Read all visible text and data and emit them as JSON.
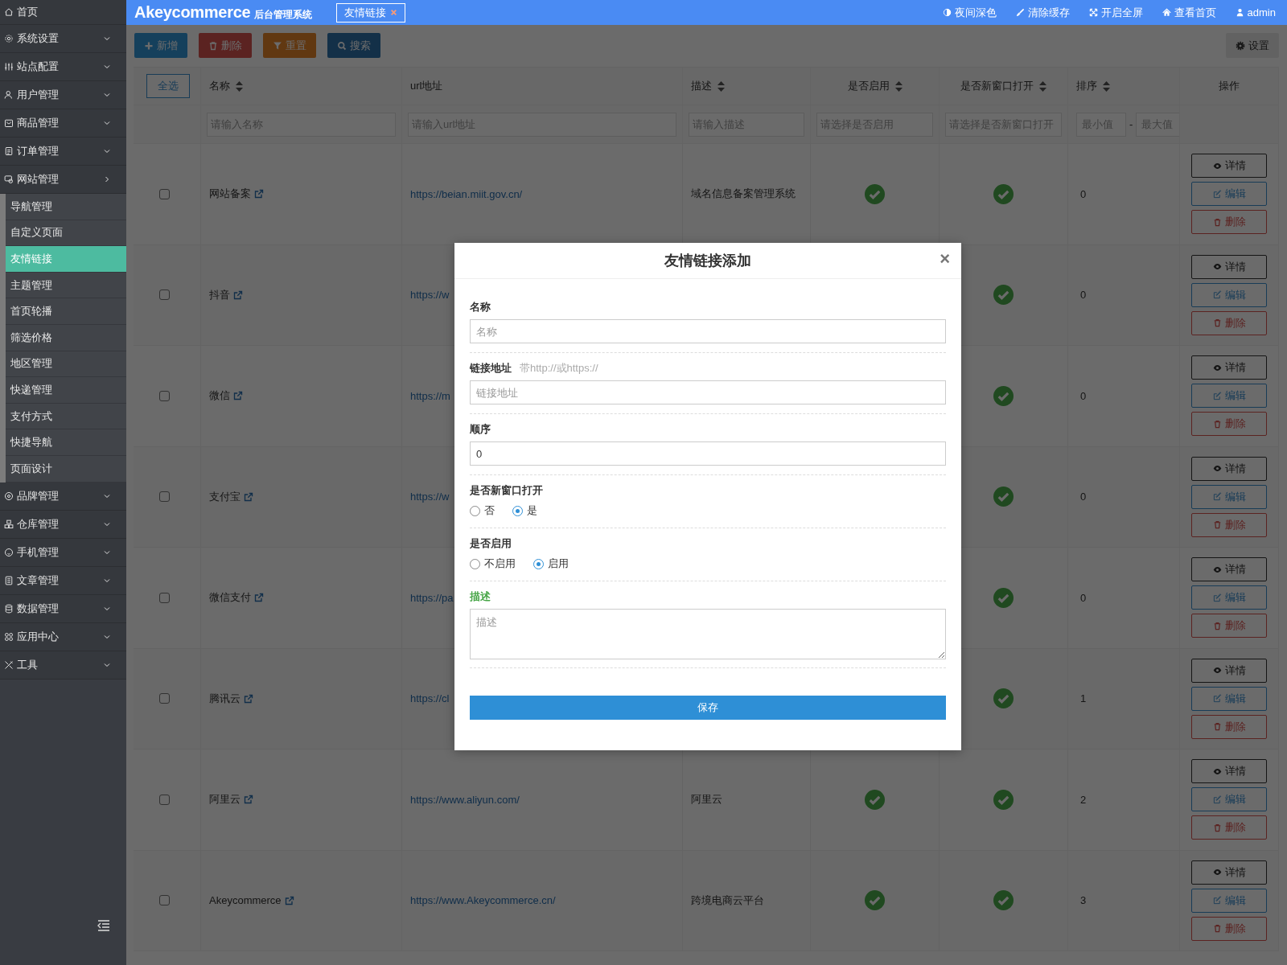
{
  "sidebar": {
    "items": [
      {
        "label": "首页",
        "kind": "link"
      },
      {
        "label": "系统设置",
        "kind": "menu",
        "expanded": false
      },
      {
        "label": "站点配置",
        "kind": "menu",
        "expanded": false
      },
      {
        "label": "用户管理",
        "kind": "menu",
        "expanded": false
      },
      {
        "label": "商品管理",
        "kind": "menu",
        "expanded": false
      },
      {
        "label": "订单管理",
        "kind": "menu",
        "expanded": false
      },
      {
        "label": "网站管理",
        "kind": "menu",
        "expanded": true,
        "children": [
          {
            "label": "导航管理",
            "selected": false
          },
          {
            "label": "自定义页面",
            "selected": false
          },
          {
            "label": "友情链接",
            "selected": true
          },
          {
            "label": "主题管理",
            "selected": false
          },
          {
            "label": "首页轮播",
            "selected": false
          },
          {
            "label": "筛选价格",
            "selected": false
          },
          {
            "label": "地区管理",
            "selected": false
          },
          {
            "label": "快递管理",
            "selected": false
          },
          {
            "label": "支付方式",
            "selected": false
          },
          {
            "label": "快捷导航",
            "selected": false
          },
          {
            "label": "页面设计",
            "selected": false
          }
        ]
      },
      {
        "label": "品牌管理",
        "kind": "menu",
        "expanded": false
      },
      {
        "label": "仓库管理",
        "kind": "menu",
        "expanded": false
      },
      {
        "label": "手机管理",
        "kind": "menu",
        "expanded": false
      },
      {
        "label": "文章管理",
        "kind": "menu",
        "expanded": false
      },
      {
        "label": "数据管理",
        "kind": "menu",
        "expanded": false
      },
      {
        "label": "应用中心",
        "kind": "menu",
        "expanded": false
      },
      {
        "label": "工具",
        "kind": "menu",
        "expanded": false
      }
    ]
  },
  "topbar": {
    "logo": "Akeycommerce",
    "subtitle": "后台管理系统",
    "tabs": [
      {
        "label": "友情链接",
        "selected": true
      }
    ],
    "actions": [
      {
        "label": "夜间深色"
      },
      {
        "label": "清除缓存"
      },
      {
        "label": "开启全屏"
      },
      {
        "label": "查看首页"
      },
      {
        "label": "admin"
      }
    ]
  },
  "toolbar": {
    "buttons": [
      {
        "label": "新增",
        "kind": "primary"
      },
      {
        "label": "删除",
        "kind": "danger"
      },
      {
        "label": "重置",
        "kind": "warning"
      },
      {
        "label": "搜索",
        "kind": "info"
      }
    ],
    "settings": "设置"
  },
  "table": {
    "select_all": "全选",
    "columns": [
      {
        "label": "名称",
        "sortable": true
      },
      {
        "label": "url地址",
        "sortable": false
      },
      {
        "label": "描述",
        "sortable": true
      },
      {
        "label": "是否启用",
        "sortable": true
      },
      {
        "label": "是否新窗口打开",
        "sortable": true
      },
      {
        "label": "排序",
        "sortable": true
      },
      {
        "label": "操作",
        "sortable": false
      }
    ],
    "filters": [
      {
        "kind": "text",
        "placeholder": "请输入名称"
      },
      {
        "kind": "text",
        "placeholder": "请输入url地址"
      },
      {
        "kind": "text",
        "placeholder": "请输入描述"
      },
      {
        "kind": "text",
        "placeholder": "请选择是否启用"
      },
      {
        "kind": "text",
        "placeholder": "请选择是否新窗口打开"
      },
      {
        "kind": "range",
        "min_placeholder": "最小值",
        "separator": "-",
        "max_placeholder": "最大值"
      }
    ],
    "rows": [
      {
        "checked": false,
        "name": "网站备案",
        "url": "https://beian.miit.gov.cn/",
        "description": "域名信息备案管理系统",
        "enabled": true,
        "new_window": true,
        "sort": "0",
        "actions": [
          "详情",
          "编辑",
          "删除"
        ]
      },
      {
        "checked": false,
        "name": "抖音",
        "url": "https://w",
        "new_window": true,
        "sort": "0",
        "actions": [
          "详情",
          "编辑",
          "删除"
        ]
      },
      {
        "checked": false,
        "name": "微信",
        "url": "https://m",
        "new_window": true,
        "sort": "0",
        "actions": [
          "详情",
          "编辑",
          "删除"
        ]
      },
      {
        "checked": false,
        "name": "支付宝",
        "url": "https://w",
        "new_window": true,
        "sort": "0",
        "actions": [
          "详情",
          "编辑",
          "删除"
        ]
      },
      {
        "checked": false,
        "name": "微信支付",
        "url": "https://pa",
        "new_window": true,
        "sort": "0",
        "actions": [
          "详情",
          "编辑",
          "删除"
        ]
      },
      {
        "checked": false,
        "name": "腾讯云",
        "url": "https://cl",
        "new_window": true,
        "sort": "1",
        "actions": [
          "详情",
          "编辑",
          "删除"
        ]
      },
      {
        "checked": false,
        "name": "阿里云",
        "url": "https://www.aliyun.com/",
        "description": "阿里云",
        "enabled": true,
        "new_window": true,
        "sort": "2",
        "actions": [
          "详情",
          "编辑",
          "删除"
        ]
      },
      {
        "checked": false,
        "name": "Akeycommerce",
        "url": "https://www.Akeycommerce.cn/",
        "description": "跨境电商云平台",
        "enabled": true,
        "new_window": true,
        "sort": "3",
        "actions": [
          "详情",
          "编辑",
          "删除"
        ]
      }
    ]
  },
  "modal": {
    "title": "友情链接添加",
    "close": "×",
    "fields": [
      {
        "kind": "text",
        "label": "名称",
        "placeholder": "名称"
      },
      {
        "kind": "text",
        "label": "链接地址",
        "hint": "带http://或https://",
        "placeholder": "链接地址"
      },
      {
        "kind": "text",
        "label": "顺序",
        "value": "0"
      },
      {
        "kind": "radio",
        "label": "是否新窗口打开",
        "options": [
          {
            "label": "否",
            "selected": false
          },
          {
            "label": "是",
            "selected": true
          }
        ]
      },
      {
        "kind": "radio",
        "label": "是否启用",
        "options": [
          {
            "label": "不启用",
            "selected": false
          },
          {
            "label": "启用",
            "selected": true
          }
        ]
      },
      {
        "kind": "textarea",
        "label": "描述",
        "placeholder": "描述",
        "valid": true
      }
    ],
    "submit": "保存"
  }
}
